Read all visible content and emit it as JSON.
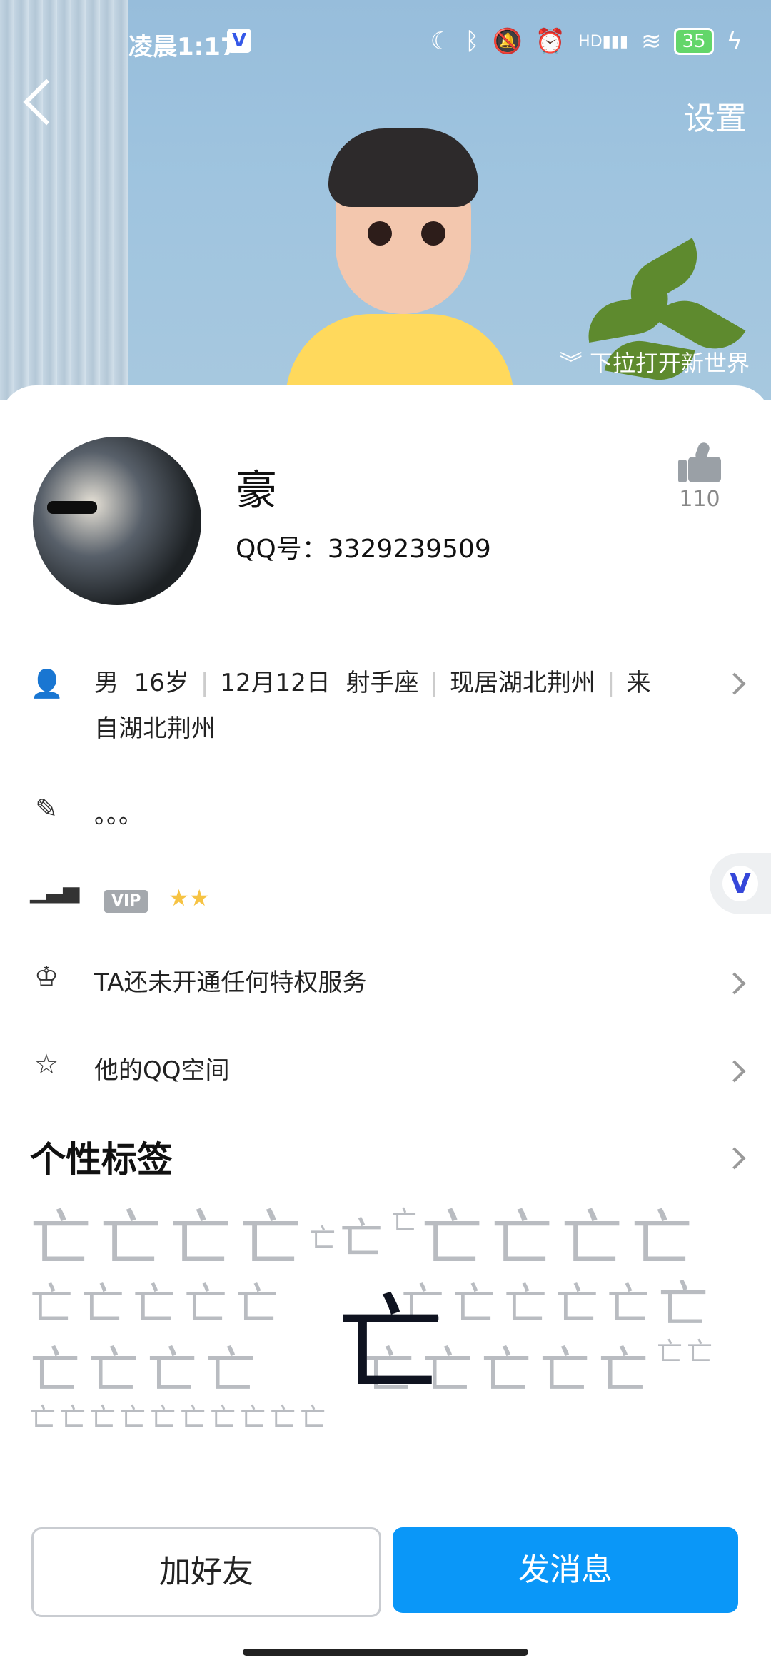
{
  "status_bar": {
    "time": "凌晨1:17",
    "app_badge": "V",
    "battery": "35",
    "network": "HD"
  },
  "header": {
    "settings_label": "设置",
    "pull_tip": "下拉打开新世界"
  },
  "profile": {
    "nickname": "豪",
    "qq_label": "QQ号",
    "qq_number": "3329239509",
    "like_count": "110"
  },
  "info": {
    "gender": "男",
    "age": "16岁",
    "birthday": "12月12日",
    "zodiac": "射手座",
    "location": "现居湖北荆州",
    "hometown_prefix": "来",
    "hometown_rest": "自湖北荆州",
    "signature": "。。。"
  },
  "level": {
    "vip_label": "VIP",
    "stars": "★★"
  },
  "menu": {
    "privilege": "TA还未开通任何特权服务",
    "qzone": "他的QQ空间"
  },
  "tags": {
    "title": "个性标签",
    "glyph": "亡"
  },
  "actions": {
    "add_friend": "加好友",
    "send_message": "发消息"
  }
}
